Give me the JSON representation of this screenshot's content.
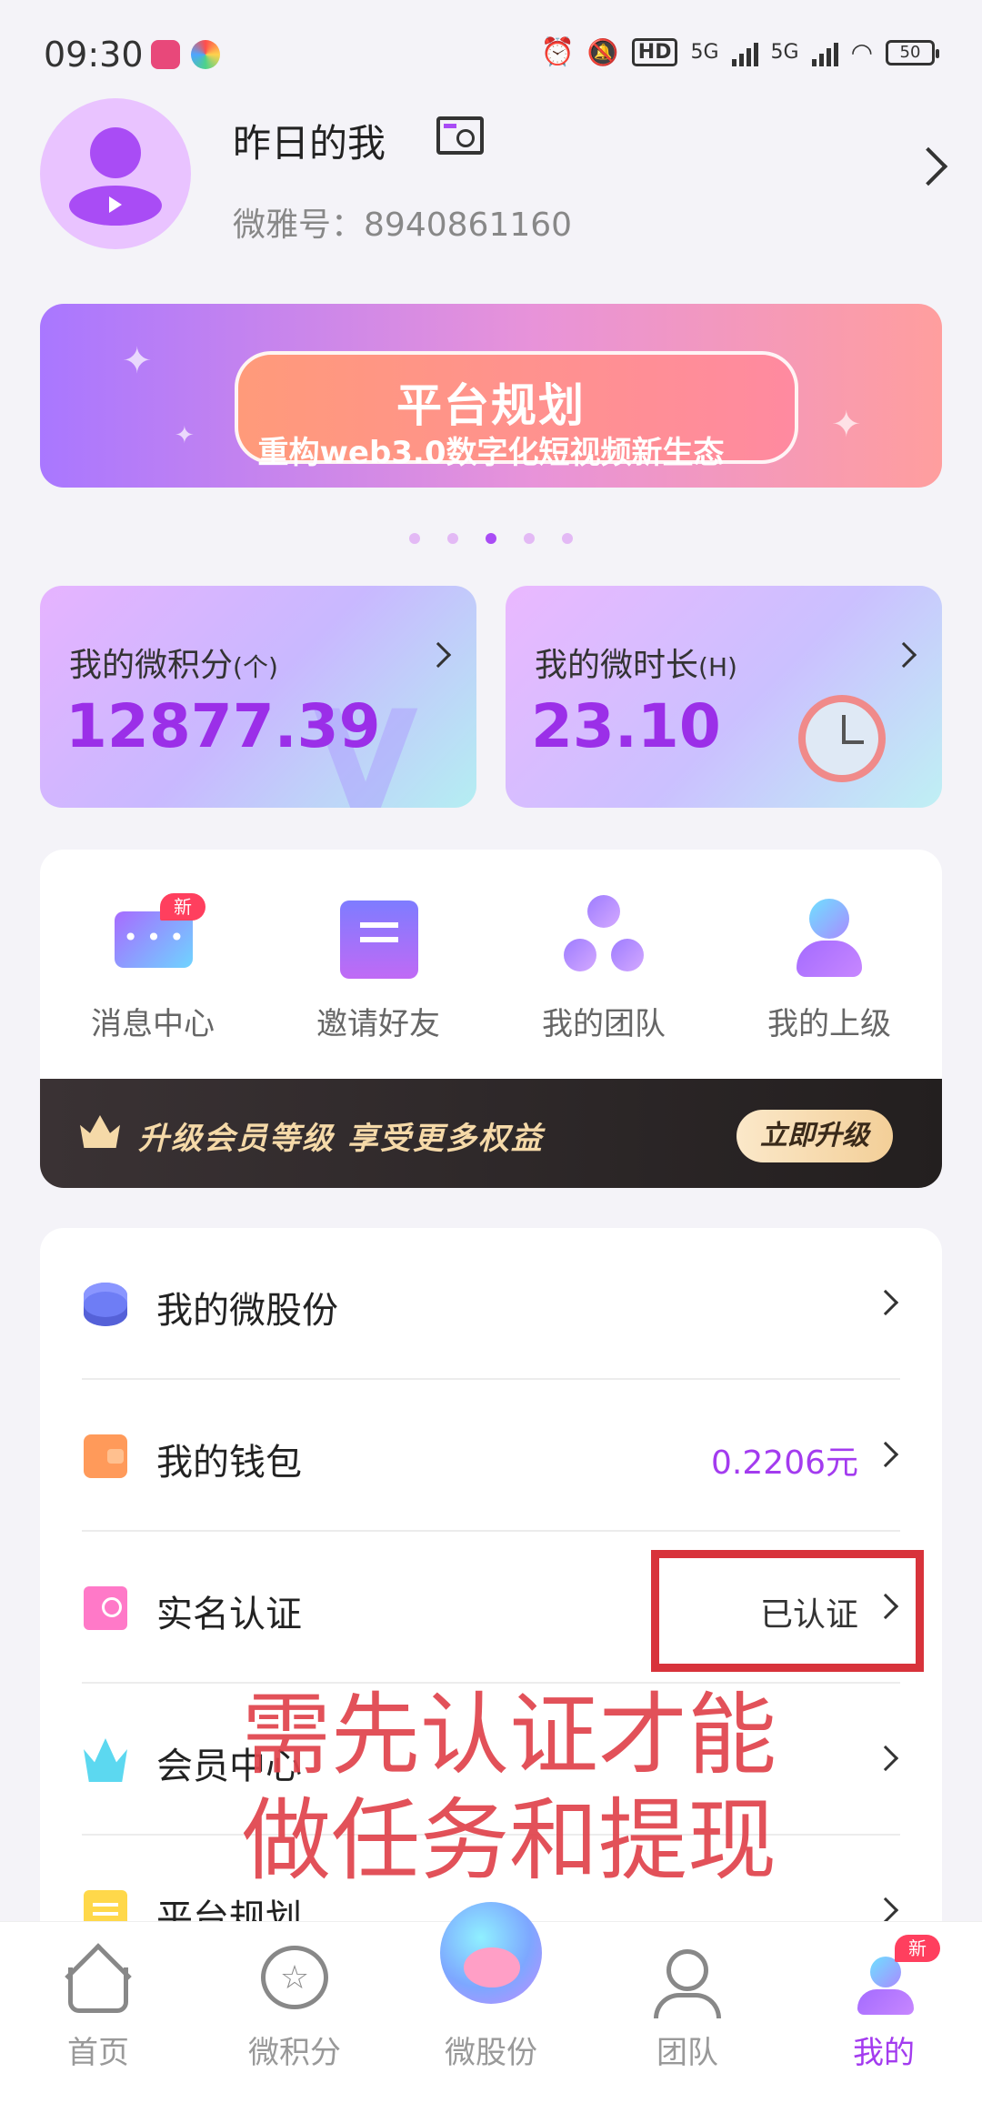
{
  "status_bar": {
    "time": "09:30",
    "network_1": "5G",
    "network_2": "5G",
    "hd_label": "HD",
    "battery": "50"
  },
  "profile": {
    "nickname": "昨日的我",
    "id_label": "微雅号：",
    "id_value": "8940861160"
  },
  "banner": {
    "title": "平台规划",
    "subtitle": "重构web3.0数字化短视频新生态",
    "page_count": 5,
    "active_index": 2
  },
  "stats": {
    "points": {
      "label": "我的微积分",
      "unit": "(个)",
      "value": "12877.39"
    },
    "hours": {
      "label": "我的微时长",
      "unit": "(H)",
      "value": "23.10"
    }
  },
  "quick": {
    "items": [
      {
        "label": "消息中心",
        "icon": "message-icon",
        "badge": "新"
      },
      {
        "label": "邀请好友",
        "icon": "invite-icon"
      },
      {
        "label": "我的团队",
        "icon": "team-icon"
      },
      {
        "label": "我的上级",
        "icon": "superior-icon"
      }
    ],
    "vip": {
      "text": "升级会员等级  享受更多权益",
      "button": "立即升级"
    }
  },
  "menu": {
    "items": [
      {
        "label": "我的微股份",
        "value": "",
        "icon": "database-icon"
      },
      {
        "label": "我的钱包",
        "value": "0.2206元",
        "icon": "wallet-icon",
        "value_color": "#a33bef"
      },
      {
        "label": "实名认证",
        "value": "已认证",
        "icon": "id-card-icon"
      },
      {
        "label": "会员中心",
        "value": "",
        "icon": "crown-icon"
      },
      {
        "label": "平台规划",
        "value": "",
        "icon": "plan-icon"
      }
    ]
  },
  "annotation": {
    "line1": "需先认证才能",
    "line2": "做任务和提现",
    "color": "#e0434b"
  },
  "tabbar": {
    "tabs": [
      {
        "label": "首页",
        "icon": "home-icon"
      },
      {
        "label": "微积分",
        "icon": "star-icon"
      },
      {
        "label": "微股份",
        "icon": "piggy-bank-icon"
      },
      {
        "label": "团队",
        "icon": "team-icon"
      },
      {
        "label": "我的",
        "icon": "profile-icon",
        "badge": "新",
        "active": true
      }
    ]
  }
}
